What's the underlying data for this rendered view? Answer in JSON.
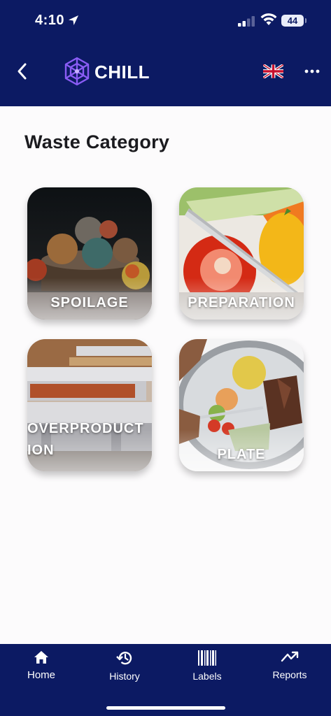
{
  "status_bar": {
    "time": "4:10",
    "battery": "44"
  },
  "header": {
    "app_name": "CHILL",
    "language": "English (UK)"
  },
  "page": {
    "title": "Waste Category"
  },
  "categories": [
    {
      "label": "SPOILAGE"
    },
    {
      "label": "PREPARATION"
    },
    {
      "label": "OVERPRODUCT",
      "label_line2": "ION"
    },
    {
      "label": "PLATE"
    }
  ],
  "tabs": [
    {
      "label": "Home",
      "icon": "home-icon"
    },
    {
      "label": "History",
      "icon": "history-icon"
    },
    {
      "label": "Labels",
      "icon": "barcode-icon"
    },
    {
      "label": "Reports",
      "icon": "trend-icon"
    }
  ],
  "colors": {
    "brand": "#0c1a63",
    "background": "#fcfbfc",
    "logo_accent": "#8a5cf5"
  }
}
